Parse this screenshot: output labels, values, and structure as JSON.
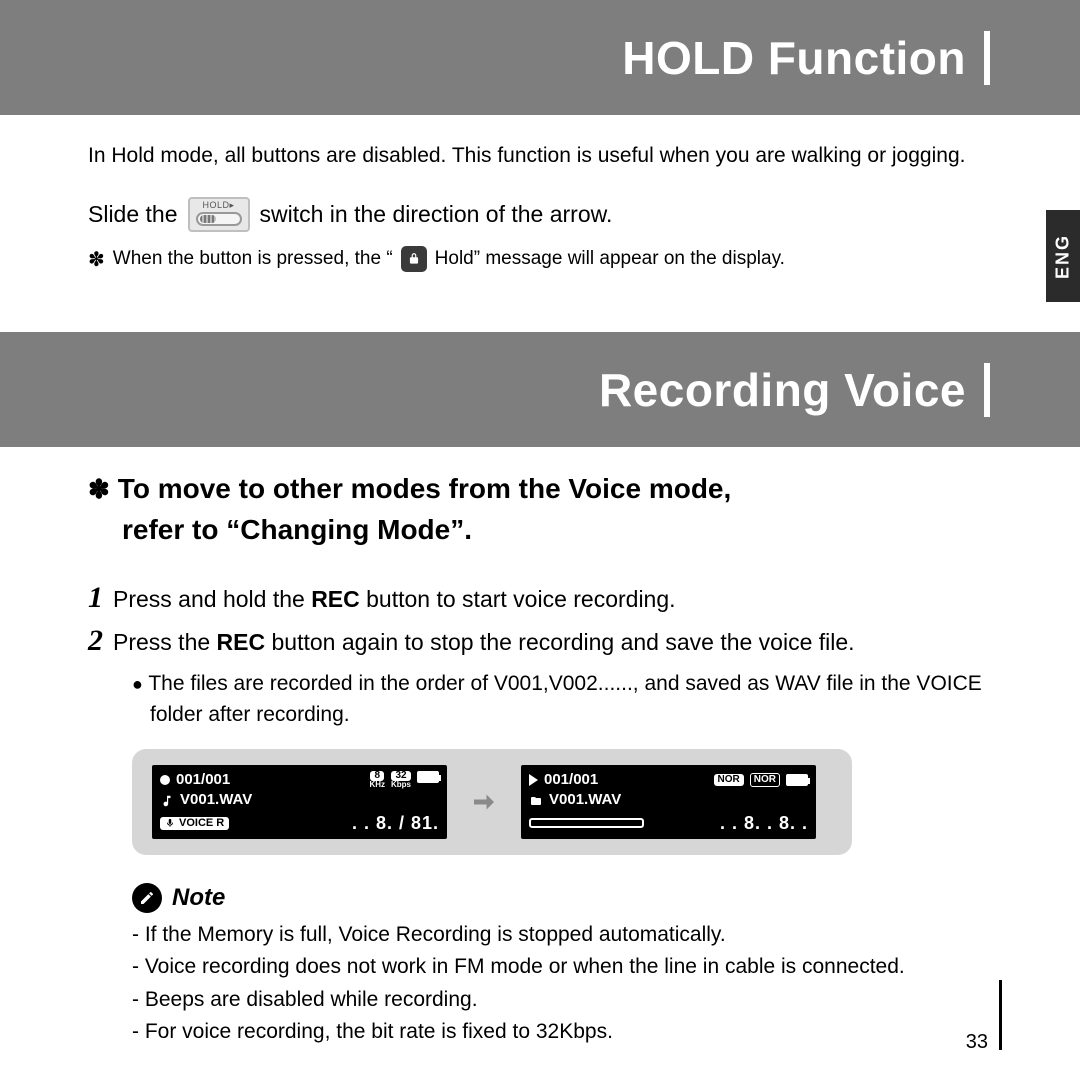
{
  "header1": "HOLD Function",
  "header2": "Recording Voice",
  "lang_tab": "ENG",
  "hold_section": {
    "intro": "In Hold mode, all buttons are disabled. This function is useful when you are walking or jogging.",
    "slide_before": "Slide the",
    "slide_after": "switch in the direction of the arrow.",
    "hold_switch_label": "HOLD▸",
    "subnote_before": "When the button is pressed, the “",
    "subnote_after": "Hold” message will appear on the display."
  },
  "voice_section": {
    "crossref_line1": "To move to other modes from the Voice mode,",
    "crossref_line2": "refer to “Changing Mode”.",
    "steps": [
      {
        "n": "1",
        "before": "Press and hold the ",
        "bold": "REC",
        "after": " button to start voice recording."
      },
      {
        "n": "2",
        "before": "Press the ",
        "bold": "REC",
        "after": " button again to stop the recording and save the voice file."
      }
    ],
    "file_order_note": "The files are recorded in the order of V001,V002......,  and saved as WAV file in the VOICE folder after recording."
  },
  "lcd_left": {
    "track": "001/001",
    "khz": "8",
    "kbps": "32",
    "khz_unit": "KHz",
    "kbps_unit": "Kbps",
    "file": "V001.WAV",
    "mode_badge": "VOICE R",
    "time": ". . 8. / 81."
  },
  "lcd_right": {
    "track": "001/001",
    "nor1": "NOR",
    "nor2": "NOR",
    "file": "V001.WAV",
    "time": ". . 8. . 8. ."
  },
  "note_label": "Note",
  "notes": [
    "If the Memory is full, Voice Recording is stopped automatically.",
    "Voice recording does not work in FM mode or when the line in cable is connected.",
    "Beeps are disabled while recording.",
    "For voice recording, the bit rate is fixed to 32Kbps."
  ],
  "page_number": "33"
}
